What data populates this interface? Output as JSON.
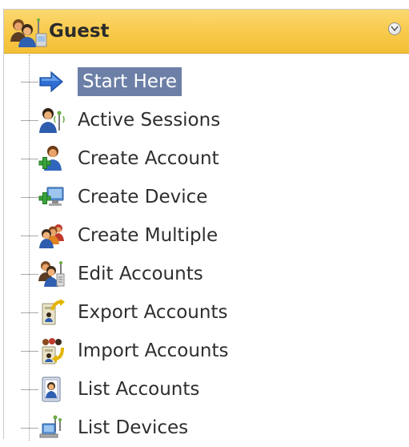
{
  "panel": {
    "title": "Guest",
    "header_icon": "guest-users-icon",
    "collapse_icon": "chevron-circle-icon"
  },
  "colors": {
    "header": "#f8c94a",
    "selected_bg": "#6c7fa6",
    "selected_text": "#ffffff"
  },
  "items": [
    {
      "label": "Start Here",
      "icon": "arrow-right-icon",
      "selected": true
    },
    {
      "label": "Active Sessions",
      "icon": "session-user-icon",
      "selected": false
    },
    {
      "label": "Create Account",
      "icon": "add-user-icon",
      "selected": false
    },
    {
      "label": "Create Device",
      "icon": "add-device-icon",
      "selected": false
    },
    {
      "label": "Create Multiple",
      "icon": "multiple-users-icon",
      "selected": false
    },
    {
      "label": "Edit Accounts",
      "icon": "edit-users-icon",
      "selected": false
    },
    {
      "label": "Export Accounts",
      "icon": "export-icon",
      "selected": false
    },
    {
      "label": "Import Accounts",
      "icon": "import-icon",
      "selected": false
    },
    {
      "label": "List Accounts",
      "icon": "list-accounts-icon",
      "selected": false
    },
    {
      "label": "List Devices",
      "icon": "list-devices-icon",
      "selected": false
    }
  ]
}
